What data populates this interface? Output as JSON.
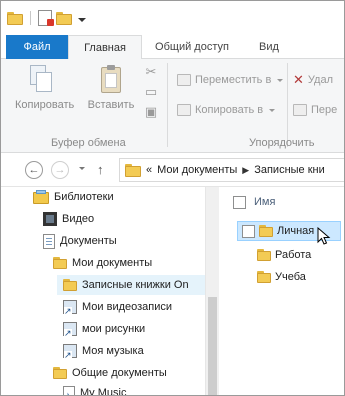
{
  "ribbon_tabs": [
    "Файл",
    "Главная",
    "Общий доступ",
    "Вид"
  ],
  "ribbon": {
    "copy_label": "Копировать",
    "paste_label": "Вставить",
    "clipboard_group": "Буфер обмена",
    "move_to": "Переместить в",
    "copy_to": "Копировать в",
    "delete_trunc": "Удал",
    "rename_trunc": "Пере",
    "organize_group": "Упорядочить"
  },
  "address": {
    "overflow": "«",
    "crumbs": [
      "Мои документы",
      "Записные кни"
    ]
  },
  "tree": [
    {
      "label": "Библиотеки",
      "icon": "library-icon"
    },
    {
      "label": "Видео",
      "icon": "video-library-icon"
    },
    {
      "label": "Документы",
      "icon": "documents-library-icon"
    },
    {
      "label": "Мои документы",
      "icon": "folder-icon"
    },
    {
      "label": "Записные книжки On",
      "icon": "folder-icon"
    },
    {
      "label": "Мои видеозаписи",
      "icon": "shortcut-icon"
    },
    {
      "label": "мои рисунки",
      "icon": "shortcut-icon"
    },
    {
      "label": "Моя музыка",
      "icon": "shortcut-icon"
    },
    {
      "label": "Общие документы",
      "icon": "folder-icon"
    },
    {
      "label": "My Music",
      "icon": "music-icon"
    }
  ],
  "files": {
    "column_name": "Имя",
    "items": [
      "Личная",
      "Работа",
      "Учеба"
    ],
    "selected_index": 0
  },
  "colors": {
    "file_tab": "#1979ca",
    "selection": "#cce8ff",
    "folder": "#f3cb54"
  }
}
